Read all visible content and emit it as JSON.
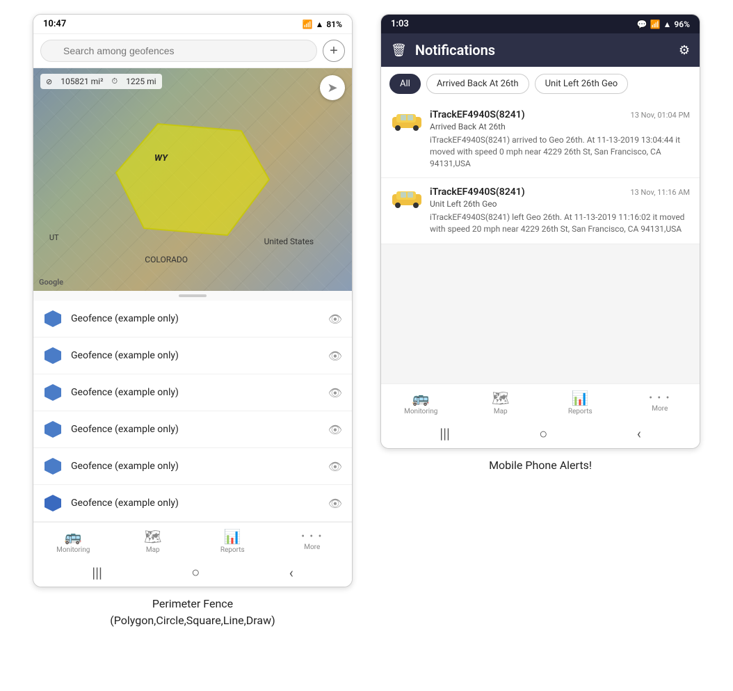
{
  "left_phone": {
    "status_bar": {
      "time": "10:47",
      "signal": "▲▼",
      "wifi": "WiFi",
      "battery": "81%"
    },
    "search": {
      "placeholder": "Search among geofences"
    },
    "map": {
      "area_label": "105821 mi²",
      "distance_label": "1225 mi",
      "labels": {
        "wy": "WY",
        "united_states": "United States",
        "colorado": "COLORADO",
        "ut": "UT"
      },
      "google": "Google"
    },
    "geofences": [
      {
        "name": "Geofence (example only)"
      },
      {
        "name": "Geofence (example only)"
      },
      {
        "name": "Geofence (example only)"
      },
      {
        "name": "Geofence (example only)"
      },
      {
        "name": "Geofence (example only)"
      },
      {
        "name": "Geofence (example only)"
      }
    ],
    "bottom_nav": [
      {
        "label": "Monitoring",
        "icon": "🚌"
      },
      {
        "label": "Map",
        "icon": "🗺"
      },
      {
        "label": "Reports",
        "icon": "📊"
      },
      {
        "label": "More",
        "icon": "•••"
      }
    ]
  },
  "right_phone": {
    "status_bar": {
      "time": "1:03",
      "chat_icon": "💬",
      "battery": "96%"
    },
    "header": {
      "title": "Notifications",
      "delete_icon": "🗑",
      "settings_icon": "⚙"
    },
    "filters": [
      {
        "label": "All",
        "active": true
      },
      {
        "label": "Arrived Back At 26th",
        "active": false
      },
      {
        "label": "Unit Left 26th Geo",
        "active": false
      }
    ],
    "notifications": [
      {
        "device": "iTrackEF4940S(8241)",
        "time": "13 Nov, 01:04 PM",
        "event": "Arrived Back At 26th",
        "description": "iTrackEF4940S(8241) arrived to Geo 26th.    At 11-13-2019 13:04:44 it moved with speed 0 mph near 4229 26th St, San Francisco, CA 94131,USA"
      },
      {
        "device": "iTrackEF4940S(8241)",
        "time": "13 Nov, 11:16 AM",
        "event": "Unit Left 26th Geo",
        "description": "iTrackEF4940S(8241) left Geo 26th.   At 11-13-2019 11:16:02 it moved with speed 20 mph near 4229 26th St, San Francisco, CA 94131,USA"
      }
    ],
    "bottom_nav": [
      {
        "label": "Monitoring",
        "icon": "🚌"
      },
      {
        "label": "Map",
        "icon": "🗺"
      },
      {
        "label": "Reports",
        "icon": "📊"
      },
      {
        "label": "More",
        "icon": "•••"
      }
    ]
  },
  "captions": {
    "left": "Perimeter Fence\n(Polygon,Circle,Square,Line,Draw)",
    "right": "Mobile Phone Alerts!"
  }
}
